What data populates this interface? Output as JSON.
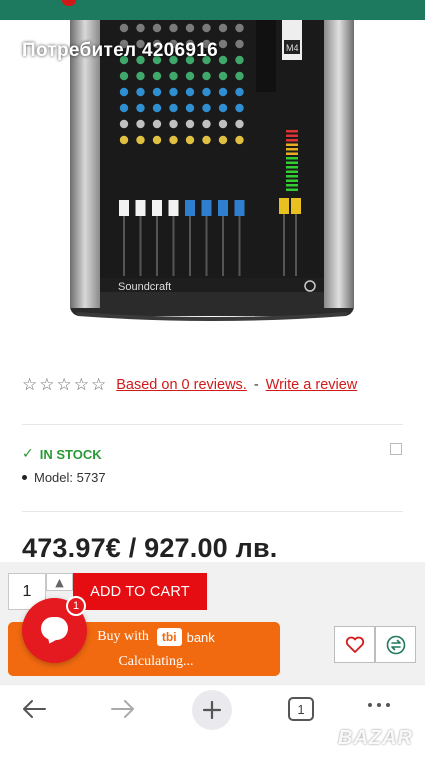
{
  "header": {
    "seller_title": "Потребител 4206916"
  },
  "product": {
    "image_brand_text": "Soundcraft",
    "image_model_badge": "M4"
  },
  "reviews": {
    "stars": [
      "☆",
      "☆",
      "☆",
      "☆",
      "☆"
    ],
    "rating_value": 0,
    "based_on": "Based on 0 reviews.",
    "separator": "-",
    "write_review": "Write a review"
  },
  "stock": {
    "status": "IN STOCK",
    "check_icon": "✓",
    "model": "Model: 5737"
  },
  "price": {
    "text": "473.97€ / 927.00 лв."
  },
  "cart": {
    "quantity": "1",
    "qty_up_icon": "▲",
    "add_to_cart": "ADD TO CART"
  },
  "tbi": {
    "buy_with": "Buy with",
    "logo": "tbi",
    "bank": "bank",
    "calculating": "Calculating..."
  },
  "chat": {
    "badge_count": "1"
  },
  "browser": {
    "tab_count": "1"
  },
  "watermark": {
    "text": "BAZAR"
  },
  "colors": {
    "brand_green": "#1e7a5e",
    "cart_red": "#e50d12",
    "tbi_orange": "#f26a10",
    "stock_green": "#2a9a36",
    "link_red": "#d11a1a"
  }
}
